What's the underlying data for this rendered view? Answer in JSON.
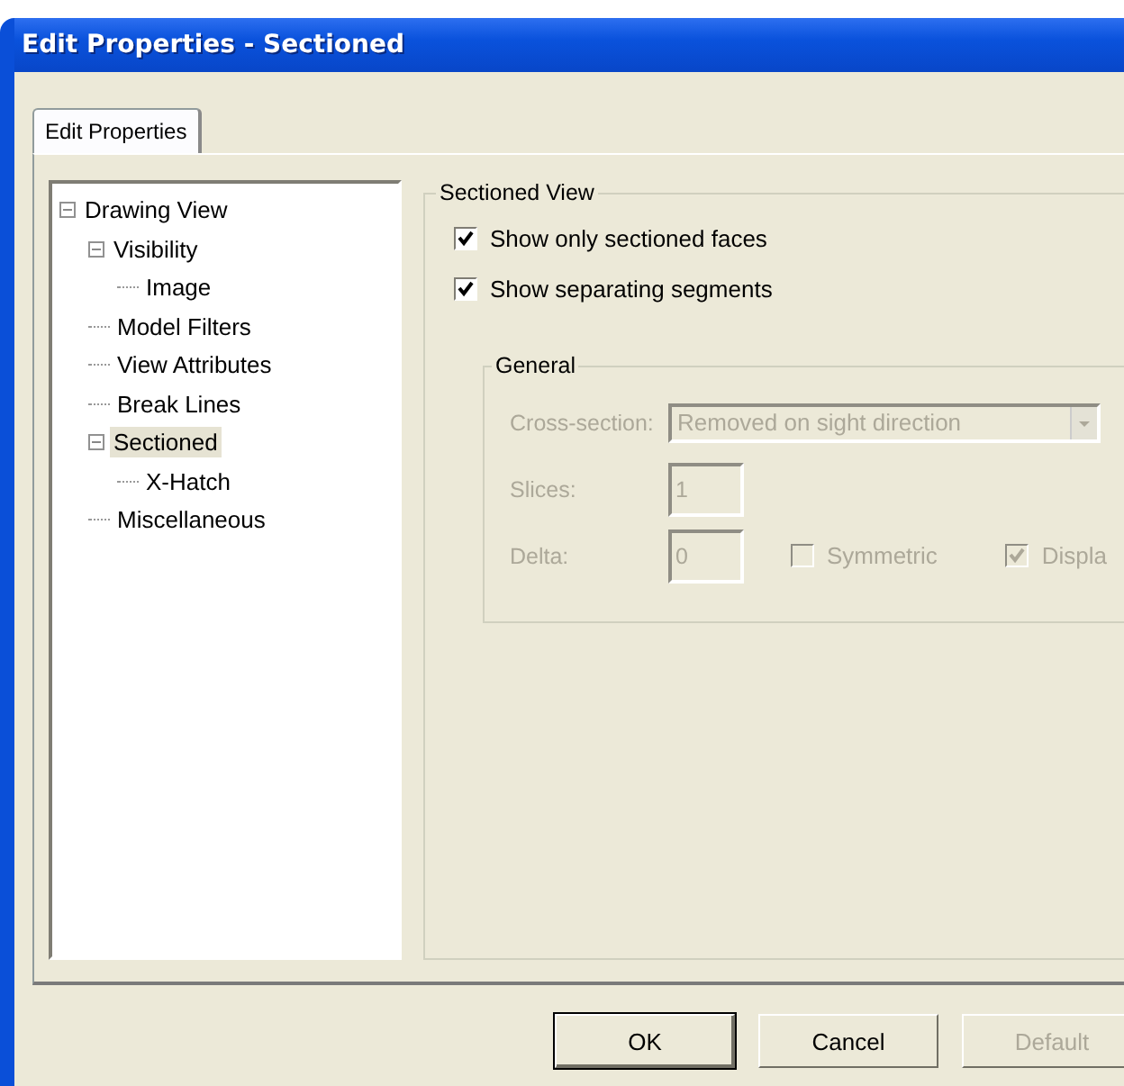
{
  "window": {
    "title": "Edit Properties - Sectioned"
  },
  "tabs": [
    {
      "label": "Edit Properties",
      "selected": true
    }
  ],
  "tree": [
    {
      "label": "Drawing View",
      "expanded": true,
      "selected": false,
      "children": [
        {
          "label": "Visibility",
          "expanded": true,
          "selected": false,
          "children": [
            {
              "label": "Image",
              "selected": false
            }
          ]
        },
        {
          "label": "Model Filters",
          "selected": false
        },
        {
          "label": "View Attributes",
          "selected": false
        },
        {
          "label": "Break Lines",
          "selected": false
        },
        {
          "label": "Sectioned",
          "expanded": true,
          "selected": true,
          "children": [
            {
              "label": "X-Hatch",
              "selected": false
            }
          ]
        },
        {
          "label": "Miscellaneous",
          "selected": false
        }
      ]
    }
  ],
  "sectioned_view": {
    "title": "Sectioned View",
    "options": [
      {
        "label": "Show only sectioned faces",
        "checked": true
      },
      {
        "label": "Show separating segments",
        "checked": true
      }
    ],
    "general": {
      "title": "General",
      "disabled": true,
      "cross_section": {
        "label": "Cross-section:",
        "value": "Removed on sight direction"
      },
      "slices": {
        "label": "Slices:",
        "value": "1"
      },
      "delta": {
        "label": "Delta:",
        "value": "0"
      },
      "symmetric": {
        "label": "Symmetric",
        "checked": false
      },
      "display": {
        "label": "Displa",
        "checked": true
      }
    }
  },
  "buttons": [
    {
      "label": "OK",
      "default": true,
      "disabled": false
    },
    {
      "label": "Cancel",
      "default": false,
      "disabled": false
    },
    {
      "label": "Default",
      "default": false,
      "disabled": true
    }
  ]
}
